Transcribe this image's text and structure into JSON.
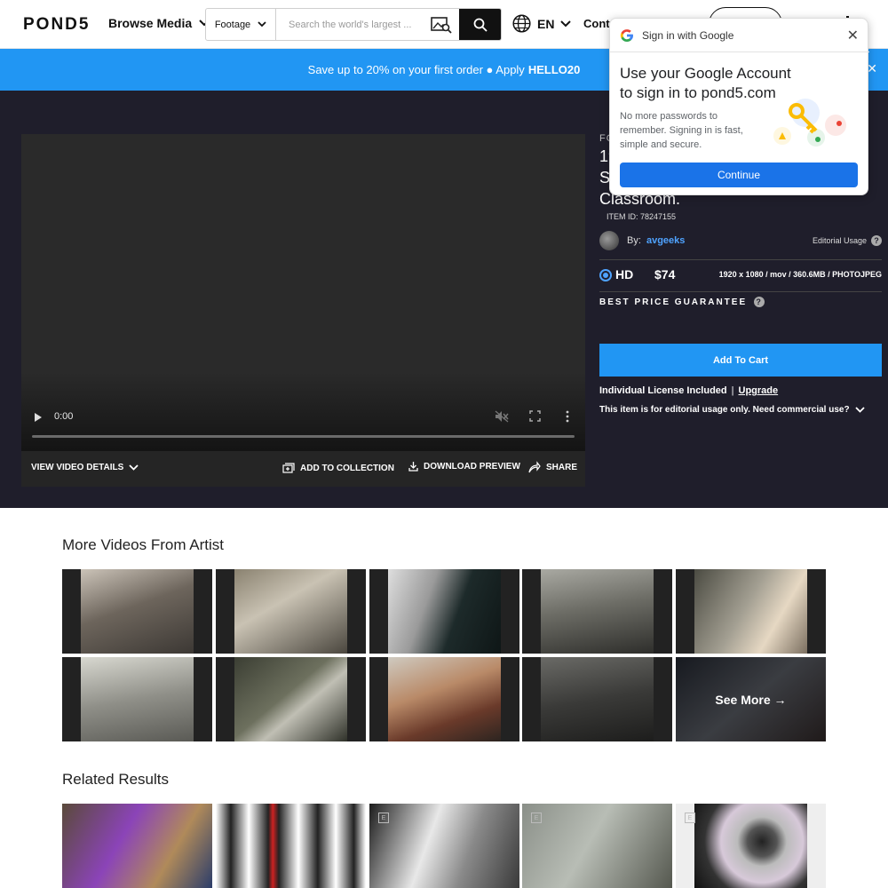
{
  "header": {
    "logo": "POND5",
    "browse_label": "Browse Media",
    "search_type": "Footage",
    "search_placeholder": "Search the world's largest ...",
    "lang": "EN",
    "contributor_partial": "Cont"
  },
  "promo": {
    "text": "Save up to 20% on your first order ● Apply",
    "code": "HELLO20"
  },
  "video": {
    "time": "0:00",
    "view_details": "VIEW VIDEO DETAILS",
    "add_to_collection": "ADD TO COLLECTION",
    "download_preview": "DOWNLOAD PREVIEW",
    "share": "SHARE"
  },
  "item": {
    "type_label": "FO",
    "title_lines": [
      "19",
      "St",
      "Classroom."
    ],
    "item_id": "ITEM ID: 78247155",
    "by_label": "By:",
    "author": "avgeeks",
    "usage": "Editorial Usage",
    "quality": "HD",
    "price": "$74",
    "specs": "1920 x 1080 / mov / 360.6MB / PHOTOJPEG",
    "guarantee": "BEST PRICE GUARANTEE",
    "cart": "Add To Cart",
    "license": "Individual License Included",
    "upgrade": "Upgrade",
    "editorial_note": "This item is for editorial usage only. Need commercial use?"
  },
  "sections": {
    "more_videos": "More Videos From Artist",
    "see_more": "See More →",
    "related": "Related Results"
  },
  "google_popup": {
    "header": "Sign in with Google",
    "title": "Use your Google Account to sign in to pond5.com",
    "body": "No more passwords to remember. Signing in is fast, simple and secure.",
    "button": "Continue"
  },
  "colors": {
    "accent": "#2196f3",
    "dark_bg": "#1f1e2b",
    "author_link": "#4fa3ff"
  }
}
